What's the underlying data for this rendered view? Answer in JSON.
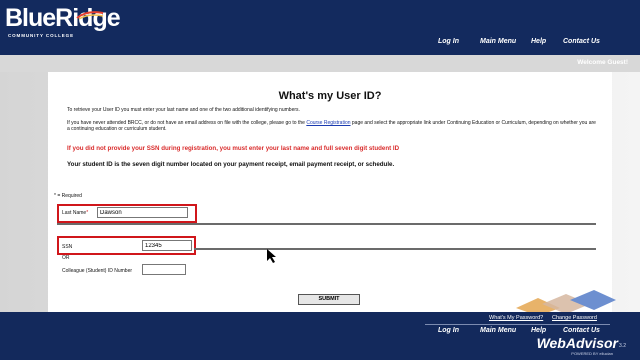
{
  "header": {
    "logo_text": "BlueRidge",
    "logo_sub": "COMMUNITY COLLEGE",
    "nav": [
      "Log In",
      "Main Menu",
      "Help",
      "Contact Us"
    ]
  },
  "welcome": "Welcome Guest!",
  "page": {
    "title": "What's my User ID?",
    "intro": "To retrieve your User ID you must enter your last name and one of the two additional identifying numbers.",
    "para_prefix": "If you have never attended BRCC, or do not have an email address on file with the college, please go to the",
    "para_link": "Course Registration",
    "para_suffix": "page and select the appropriate link under Continuing Education or Curriculum, depending on whether you are a continuing education or curriculum student.",
    "warning": "If you did not provide your SSN during registration, you must enter your last name and full seven digit student ID",
    "note": "Your student ID is the seven digit number located on your payment receipt, email payment receipt, or schedule."
  },
  "form": {
    "required_note": "* = Required",
    "last_name_label": "Last Name",
    "last_name_value": "Dawson",
    "ssn_label": "SSN",
    "ssn_value": "12345",
    "or_label": "OR",
    "colleague_label": "Colleague (Student) ID Number",
    "colleague_value": "",
    "submit_label": "SUBMIT"
  },
  "footer": {
    "links": [
      "What's My Password?",
      "Change Password"
    ],
    "nav": [
      "Log In",
      "Main Menu",
      "Help",
      "Contact Us"
    ],
    "brand": "WebAdvisor",
    "powered": "POWERED BY ellucian",
    "version": "3.2"
  },
  "colors": {
    "navy": "#132a5e",
    "highlight": "#d0161b",
    "warning": "#d92b2b"
  }
}
